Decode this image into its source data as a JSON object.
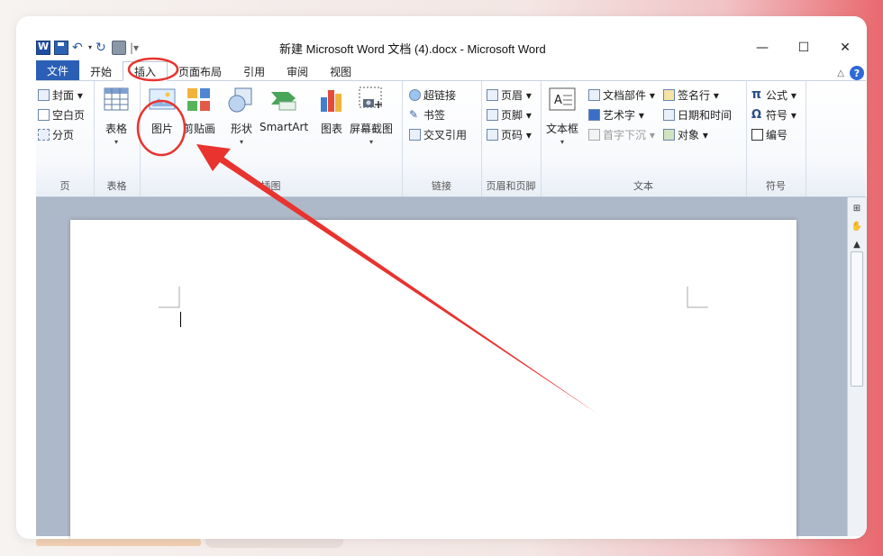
{
  "window": {
    "title": "新建 Microsoft Word 文档 (4).docx  -  Microsoft Word",
    "controls": {
      "minimize": "—",
      "maximize": "☐",
      "close": "✕"
    }
  },
  "quick_access": {
    "separator": "|▾"
  },
  "tabs": [
    {
      "label": "文件"
    },
    {
      "label": "开始"
    },
    {
      "label": "插入"
    },
    {
      "label": "页面布局"
    },
    {
      "label": "引用"
    },
    {
      "label": "审阅"
    },
    {
      "label": "视图"
    }
  ],
  "tabs_right": {
    "collapse": "△",
    "help": "?"
  },
  "ribbon": {
    "page_group": {
      "label": "页",
      "items": [
        "封面 ▾",
        "空白页",
        "分页"
      ]
    },
    "table_group": {
      "label": "表格",
      "button": "表格"
    },
    "illustrations_group": {
      "label": "插图",
      "buttons": [
        "图片",
        "剪贴画",
        "形状",
        "SmartArt",
        "图表",
        "屏幕截图"
      ]
    },
    "links_group": {
      "label": "链接",
      "items": [
        "超链接",
        "书签",
        "交叉引用"
      ]
    },
    "header_footer_group": {
      "label": "页眉和页脚",
      "items": [
        "页眉 ▾",
        "页脚 ▾",
        "页码 ▾"
      ]
    },
    "text_group": {
      "label": "文本",
      "textbox": "文本框",
      "items_col1": [
        "文档部件 ▾",
        "艺术字 ▾",
        "首字下沉 ▾"
      ],
      "items_col2": [
        "签名行 ▾",
        "日期和时间",
        "对象 ▾"
      ]
    },
    "symbols_group": {
      "label": "符号",
      "items": [
        "公式 ▾",
        "符号 ▾",
        "编号"
      ]
    }
  },
  "colors": {
    "file_tab": "#2a5fb5",
    "annotation_red": "#e8332f",
    "doc_background": "#adb8c8"
  }
}
